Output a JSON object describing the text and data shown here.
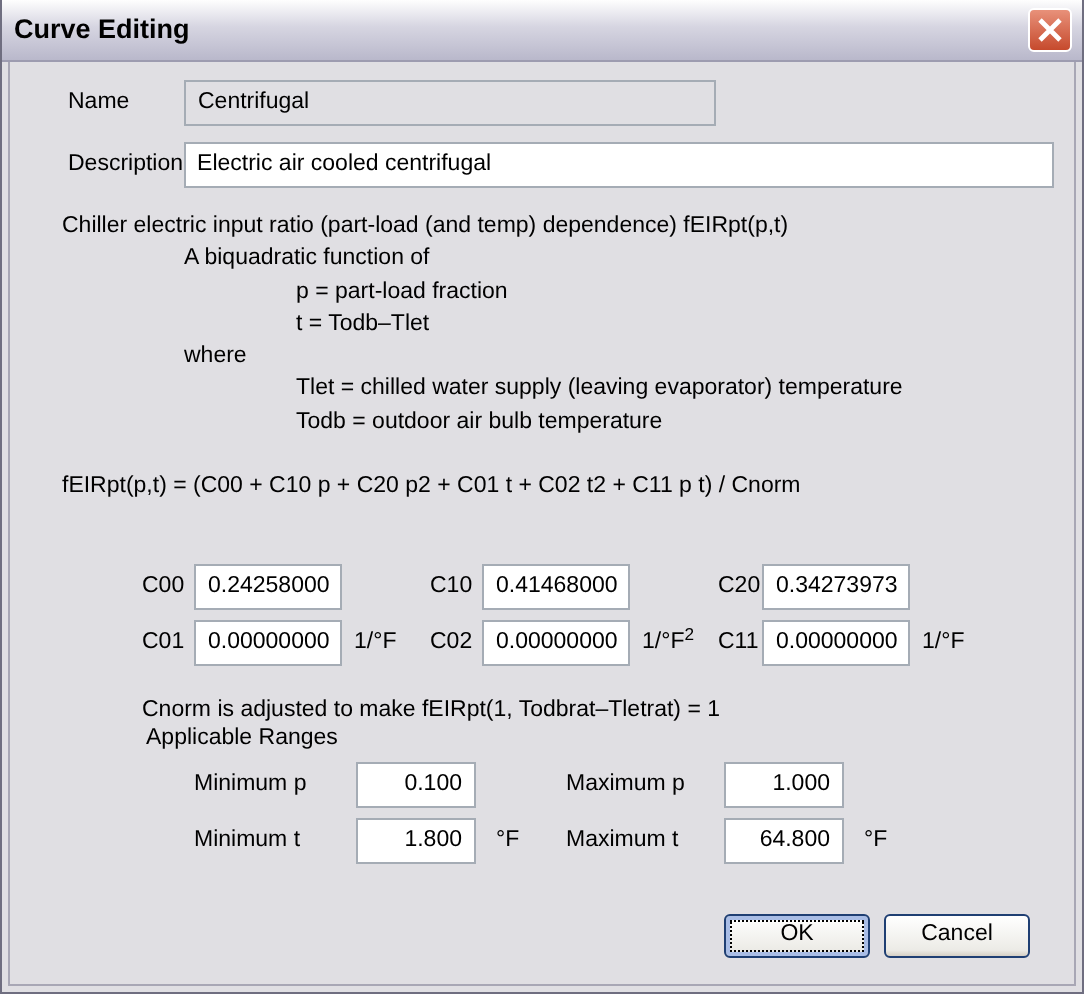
{
  "window": {
    "title": "Curve Editing"
  },
  "name": {
    "label": "Name",
    "value": "Centrifugal",
    "disabled": true
  },
  "description": {
    "label": "Description",
    "value": "Electric air cooled centrifugal",
    "disabled": false
  },
  "explanation": [
    {
      "kind": "heading",
      "text": "Chiller electric input ratio (part-load (and temp) dependence) fEIRpt(p,t)"
    },
    {
      "kind": "sub",
      "text": "A biquadratic function of"
    },
    {
      "kind": "detail",
      "text": "p = part-load fraction"
    },
    {
      "kind": "detail",
      "text": "t = Todb–Tlet"
    },
    {
      "kind": "sub",
      "text": "where"
    },
    {
      "kind": "detail",
      "text": "Tlet = chilled water supply (leaving evaporator) temperature"
    },
    {
      "kind": "detail",
      "text": "Todb = outdoor air bulb temperature"
    }
  ],
  "formula": "fEIRpt(p,t) = (C00 + C10 p + C20 p2 + C01 t + C02 t2 + C11 p t) / Cnorm",
  "coefficients": [
    {
      "label": "C00",
      "value": "0.24258000"
    },
    {
      "label": "C10",
      "value": "0.41468000"
    },
    {
      "label": "C20",
      "value": "0.34273973"
    },
    {
      "label": "C01",
      "value": "0.00000000",
      "unit": "1/°F"
    },
    {
      "label": "C02",
      "value": "0.00000000",
      "unit": "1/°F$^{2}$"
    },
    {
      "label": "C11",
      "value": "0.00000000",
      "unit": "1/°F"
    }
  ],
  "cnorm_note": "Cnorm is adjusted to make fEIRpt(1, Todbrat–Tletrat) = 1",
  "ranges_title": "Applicable Ranges",
  "ranges": [
    {
      "label": "Minimum p",
      "value": "0.100"
    },
    {
      "label": "Maximum p",
      "value": "1.000"
    },
    {
      "label": "Minimum t",
      "value": "1.800",
      "unit": "°F"
    },
    {
      "label": "Maximum t",
      "value": "64.800",
      "unit": "°F"
    }
  ],
  "buttons": [
    {
      "label": "OK",
      "default": true
    },
    {
      "label": "Cancel",
      "default": false
    }
  ]
}
